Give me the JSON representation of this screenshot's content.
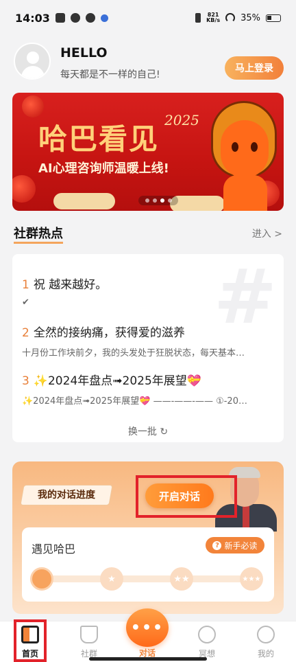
{
  "status_bar": {
    "time": "14:03",
    "net_speed_value": "821",
    "net_speed_unit": "KB/s",
    "battery": "35%"
  },
  "user": {
    "greeting": "HELLO",
    "subtitle": "每天都是不一样的自己!",
    "login_label": "马上登录"
  },
  "banner": {
    "title": "哈巴看见",
    "year": "2025",
    "subtitle": "AI心理咨询师温暖上线!"
  },
  "hot_topics": {
    "section_title": "社群热点",
    "more_label": "进入 >",
    "items": [
      {
        "num": "1",
        "title": "祝 越来越好。",
        "desc": "✔"
      },
      {
        "num": "2",
        "title": "全然的接纳痛，获得爱的滋养",
        "desc": "十月份工作块前夕，我的头发处于狂脱状态，每天基本…"
      },
      {
        "num": "3",
        "title": "✨2024年盘点➟2025年展望💝",
        "desc": "✨2024年盘点➟2025年展望💝 ——-——-—— ①-20…"
      }
    ],
    "refresh_label": "换一批 ↻"
  },
  "dialogue": {
    "progress_label": "我的对话进度",
    "start_label": "开启对话",
    "card_title": "遇见哈巴",
    "newbie_label": "新手必读",
    "newbie_icon": "?"
  },
  "nav": {
    "items": [
      {
        "label": "首页",
        "icon": "book-icon"
      },
      {
        "label": "社群",
        "icon": "cup-icon"
      },
      {
        "label": "对话",
        "icon": "chat-bubble-icon"
      },
      {
        "label": "冥想",
        "icon": "target-icon"
      },
      {
        "label": "我的",
        "icon": "smile-icon"
      }
    ]
  },
  "colors": {
    "accent": "#f2843a",
    "highlight": "#e2222a"
  }
}
